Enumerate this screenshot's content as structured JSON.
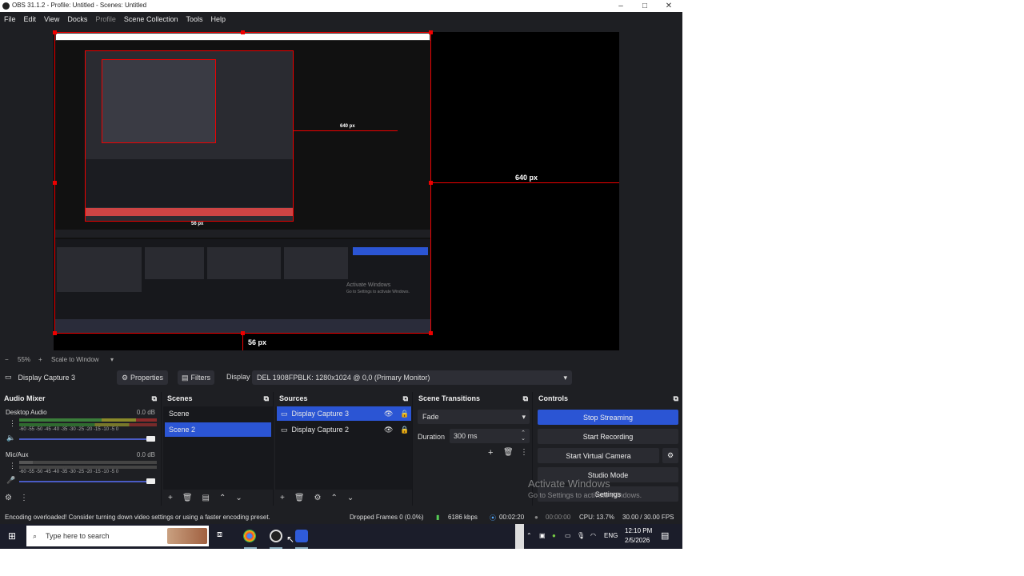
{
  "window": {
    "title": "OBS 31.1.2 - Profile: Untitled - Scenes: Untitled",
    "minimize": "–",
    "maximize": "□",
    "close": "✕"
  },
  "menu": [
    "File",
    "Edit",
    "View",
    "Docks",
    "Profile",
    "Scene Collection",
    "Tools",
    "Help"
  ],
  "preview": {
    "width_label": "640 px",
    "height_label": "56 px",
    "nested_width_label": "640 px",
    "nested_height_label": "56 px",
    "zoom": "55%",
    "scale_mode": "Scale to Window",
    "nested_watermark_title": "Activate Windows",
    "nested_watermark_sub": "Go to Settings to activate Windows."
  },
  "source_toolbar": {
    "source_name": "Display Capture 3",
    "properties": "Properties",
    "filters": "Filters",
    "display_label": "Display",
    "display_value": "DEL 1908FPBLK: 1280x1024 @ 0,0 (Primary Monitor)"
  },
  "audio_mixer": {
    "title": "Audio Mixer",
    "channels": [
      {
        "name": "Desktop Audio",
        "db": "0.0 dB"
      },
      {
        "name": "Mic/Aux",
        "db": "0.0 dB"
      }
    ],
    "scale": "-60 -55 -50 -45 -40 -35 -30 -25 -20 -15 -10 -5 0"
  },
  "scenes": {
    "title": "Scenes",
    "items": [
      "Scene",
      "Scene 2"
    ],
    "selected": 1
  },
  "sources": {
    "title": "Sources",
    "items": [
      "Display Capture 3",
      "Display Capture 2"
    ],
    "selected": 0
  },
  "transitions": {
    "title": "Scene Transitions",
    "type": "Fade",
    "duration_label": "Duration",
    "duration": "300 ms"
  },
  "controls": {
    "title": "Controls",
    "stop_streaming": "Stop Streaming",
    "start_recording": "Start Recording",
    "start_virtual_camera": "Start Virtual Camera",
    "studio_mode": "Studio Mode",
    "settings": "Settings"
  },
  "watermark": {
    "title": "Activate Windows",
    "sub": "Go to Settings to activate Windows."
  },
  "status": {
    "message": "Encoding overloaded! Consider turning down video settings or using a faster encoding preset.",
    "dropped": "Dropped Frames 0 (0.0%)",
    "bitrate": "6186 kbps",
    "stream_time": "00:02:20",
    "rec_time": "00:00:00",
    "cpu": "CPU: 13.7%",
    "fps": "30.00 / 30.00 FPS"
  },
  "taskbar": {
    "search_placeholder": "Type here to search",
    "lang": "ENG",
    "time": "12:10 PM",
    "date": "2/5/2026"
  },
  "colors": {
    "accent": "#2b55d4",
    "red": "#e00000",
    "panel": "#1e1f23"
  }
}
